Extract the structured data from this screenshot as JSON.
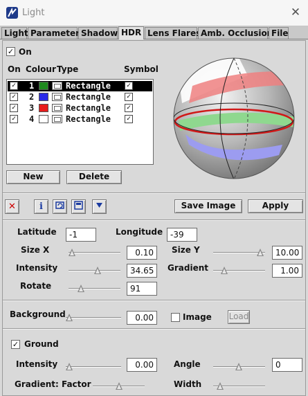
{
  "window": {
    "title": "Light",
    "close_glyph": "✕"
  },
  "tabs": [
    {
      "label": "Light"
    },
    {
      "label": "Parameter"
    },
    {
      "label": "Shadow"
    },
    {
      "label": "HDR",
      "active": true
    },
    {
      "label": "Lens Flares"
    },
    {
      "label": "Amb. Occlusion"
    },
    {
      "label": "File"
    }
  ],
  "hdr": {
    "on_label": "On",
    "on_checked": true,
    "list_headers": {
      "on": "On",
      "colour": "Colour",
      "type": "Type",
      "symbol": "Symbol"
    },
    "lights": [
      {
        "num": "1",
        "colour": "#1f8a1f",
        "type": "Rectangle",
        "on": true,
        "symbol": true,
        "selected": true
      },
      {
        "num": "2",
        "colour": "#2a2ae8",
        "type": "Rectangle",
        "on": true,
        "symbol": true
      },
      {
        "num": "3",
        "colour": "#e81c1c",
        "type": "Rectangle",
        "on": true,
        "symbol": true
      },
      {
        "num": "4",
        "colour": "#ffffff",
        "type": "Rectangle",
        "on": true,
        "symbol": true
      }
    ],
    "check_glyph": "✓",
    "new_label": "New",
    "delete_label": "Delete"
  },
  "toolbar": {
    "delete_icon": "✕",
    "info_icon": "i",
    "save_image_label": "Save Image",
    "apply_label": "Apply"
  },
  "params": {
    "latitude_label": "Latitude",
    "latitude_value": "-1",
    "longitude_label": "Longitude",
    "longitude_value": "-39",
    "size_x_label": "Size X",
    "size_x_value": "0.10",
    "size_y_label": "Size Y",
    "size_y_value": "10.00",
    "intensity_label": "Intensity",
    "intensity_value": "34.65",
    "gradient_label": "Gradient",
    "gradient_value": "1.00",
    "rotate_label": "Rotate",
    "rotate_value": "91"
  },
  "background": {
    "label": "Background",
    "value": "0.00",
    "image_label": "Image",
    "image_checked": false,
    "load_label": "Load"
  },
  "ground": {
    "label": "Ground",
    "checked": true,
    "intensity_label": "Intensity",
    "intensity_value": "0.00",
    "angle_label": "Angle",
    "angle_value": "0",
    "gradient_factor_label": "Gradient: Factor",
    "width_label": "Width"
  }
}
